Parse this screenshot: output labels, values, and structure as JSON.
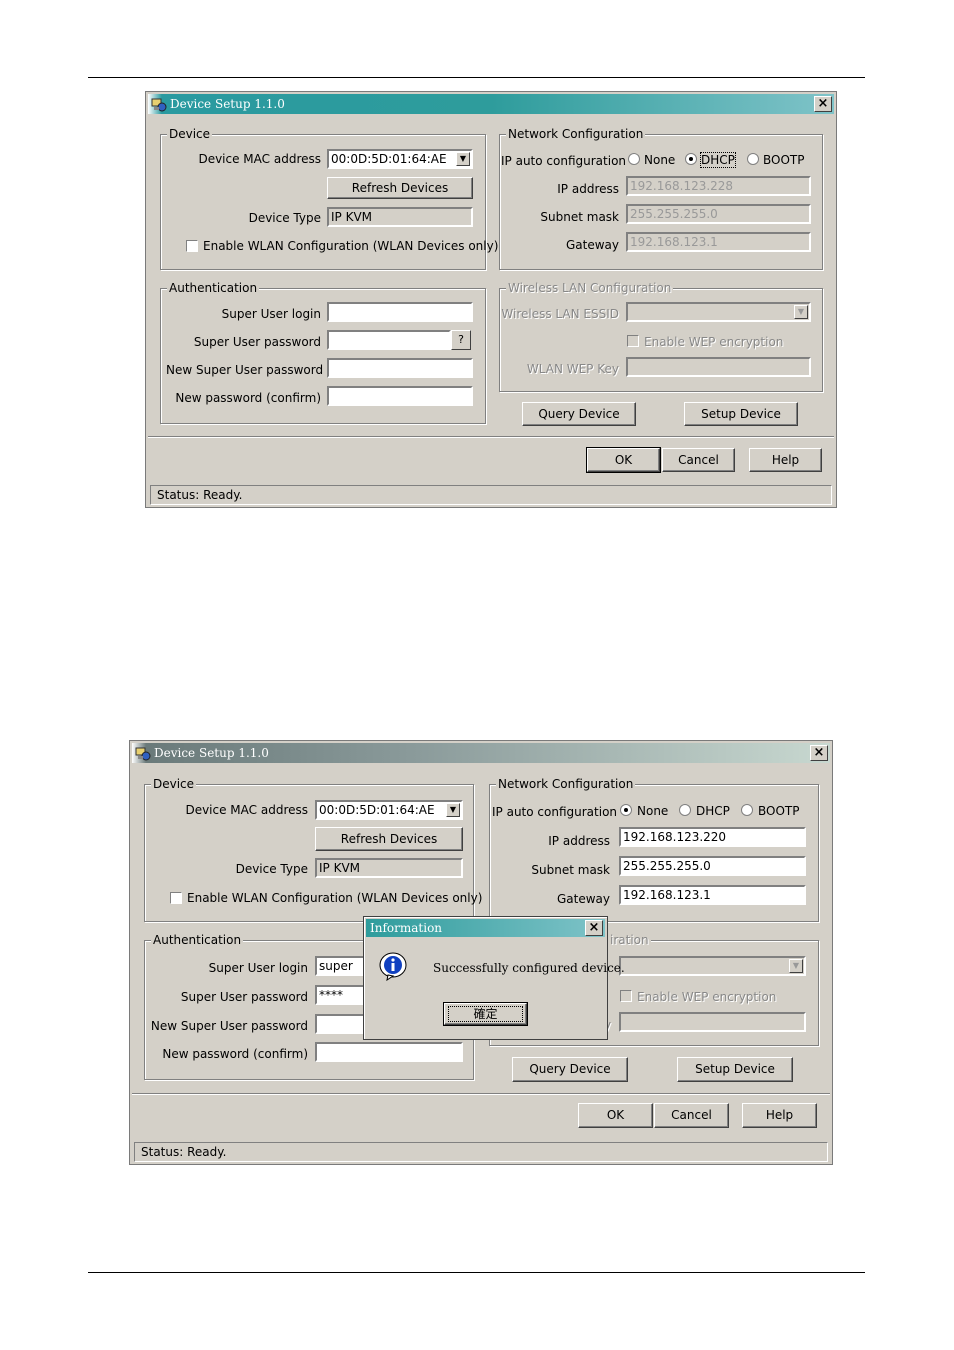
{
  "window1": {
    "title": "Device Setup 1.1.0",
    "device": {
      "legend": "Device",
      "mac_label": "Device MAC address",
      "mac_value": "00:0D:5D:01:64:AE",
      "refresh_label": "Refresh Devices",
      "type_label": "Device Type",
      "type_value": "IP KVM",
      "wlan_checkbox_label": "Enable WLAN Configuration (WLAN Devices only)"
    },
    "network": {
      "legend": "Network Configuration",
      "auto_label": "IP auto configuration",
      "options": [
        "None",
        "DHCP",
        "BOOTP"
      ],
      "selected": "DHCP",
      "ip_label": "IP address",
      "ip_value": "192.168.123.228",
      "mask_label": "Subnet mask",
      "mask_value": "255.255.255.0",
      "gw_label": "Gateway",
      "gw_value": "192.168.123.1"
    },
    "auth": {
      "legend": "Authentication",
      "login_label": "Super User login",
      "login_value": "",
      "pw_label": "Super User password",
      "pw_value": "",
      "pw_help": "?",
      "newpw_label": "New Super User password",
      "newpw_value": "",
      "confirm_label": "New password (confirm)",
      "confirm_value": ""
    },
    "wireless": {
      "legend": "Wireless LAN Configuration",
      "essid_label": "Wireless LAN ESSID",
      "wep_checkbox_label": "Enable WEP encryption",
      "wep_key_label": "WLAN WEP Key"
    },
    "query_label": "Query Device",
    "setup_label": "Setup Device",
    "ok_label": "OK",
    "cancel_label": "Cancel",
    "help_label": "Help",
    "status": "Status: Ready."
  },
  "window2": {
    "title": "Device Setup 1.1.0",
    "device": {
      "legend": "Device",
      "mac_label": "Device MAC address",
      "mac_value": "00:0D:5D:01:64:AE",
      "refresh_label": "Refresh Devices",
      "type_label": "Device Type",
      "type_value": "IP KVM",
      "wlan_checkbox_label": "Enable WLAN Configuration (WLAN Devices only)"
    },
    "network": {
      "legend": "Network Configuration",
      "auto_label": "IP auto configuration",
      "options": [
        "None",
        "DHCP",
        "BOOTP"
      ],
      "selected": "None",
      "ip_label": "IP address",
      "ip_value": "192.168.123.220",
      "mask_label": "Subnet mask",
      "mask_value": "255.255.255.0",
      "gw_label": "Gateway",
      "gw_value": "192.168.123.1"
    },
    "auth": {
      "legend": "Authentication",
      "login_label": "Super User login",
      "login_value": "super",
      "pw_label": "Super User password",
      "pw_value": "****",
      "newpw_label": "New Super User password",
      "newpw_value": "",
      "confirm_label": "New password (confirm)",
      "confirm_value": ""
    },
    "wireless": {
      "legend_visible": "iration",
      "essid_suffix": "D",
      "wep_checkbox_label": "Enable WEP encryption",
      "wep_key_suffix": "y"
    },
    "query_label": "Query Device",
    "setup_label": "Setup Device",
    "ok_label": "OK",
    "cancel_label": "Cancel",
    "help_label": "Help",
    "status": "Status: Ready."
  },
  "dialog": {
    "title": "Information",
    "message": "Successfully configured device.",
    "ok_label": "確定"
  }
}
